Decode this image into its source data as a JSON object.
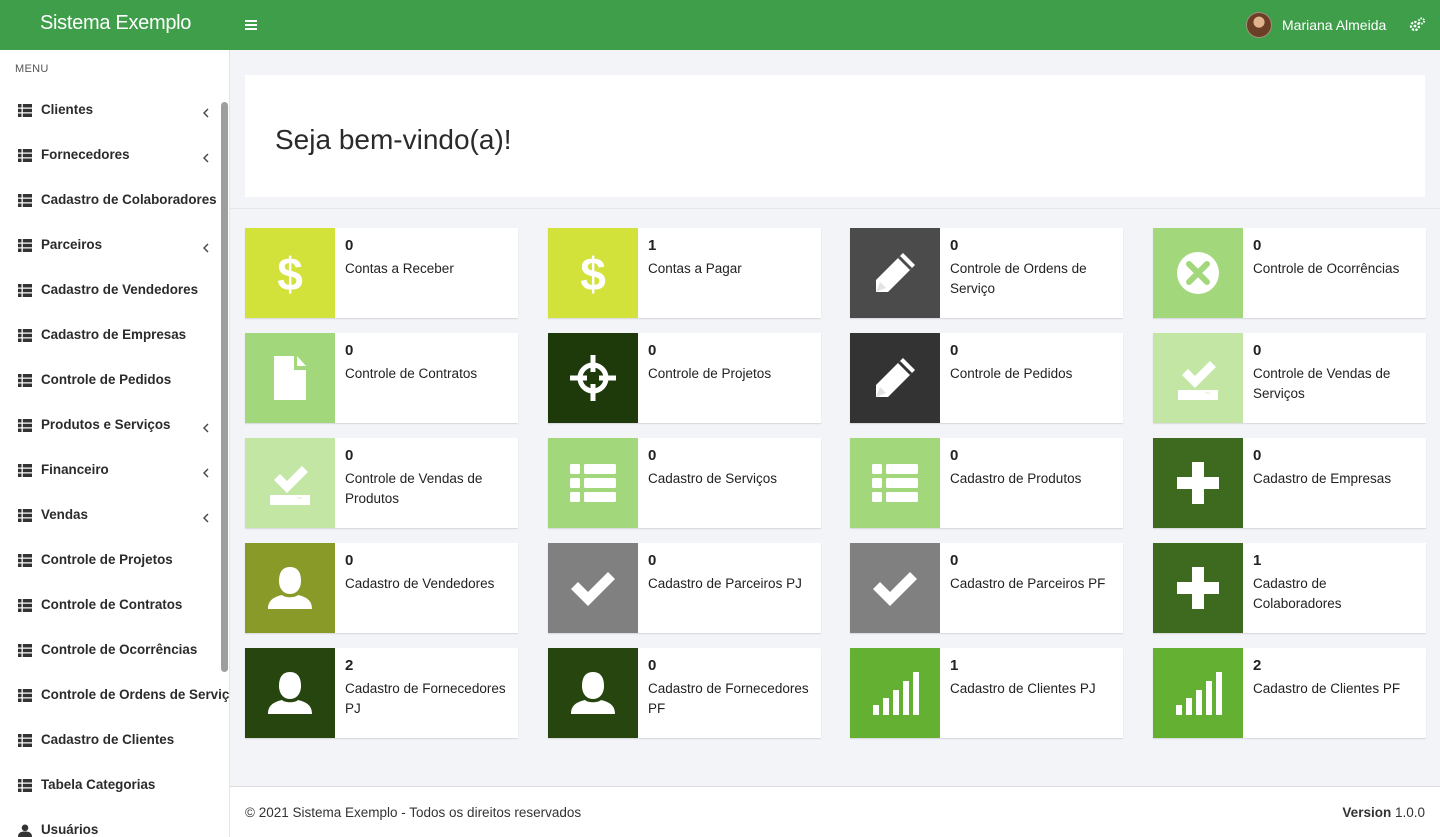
{
  "header": {
    "brand": "Sistema Exemplo",
    "user_name": "Mariana Almeida",
    "color": "#3f9e4a"
  },
  "sidebar": {
    "menu_label": "MENU",
    "items": [
      {
        "label": "Clientes",
        "icon": "th-list-icon",
        "has_submenu": true
      },
      {
        "label": "Fornecedores",
        "icon": "th-list-icon",
        "has_submenu": true
      },
      {
        "label": "Cadastro de Colaboradores",
        "icon": "th-list-icon",
        "has_submenu": false
      },
      {
        "label": "Parceiros",
        "icon": "th-list-icon",
        "has_submenu": true
      },
      {
        "label": "Cadastro de Vendedores",
        "icon": "th-list-icon",
        "has_submenu": false
      },
      {
        "label": "Cadastro de Empresas",
        "icon": "th-list-icon",
        "has_submenu": false
      },
      {
        "label": "Controle de Pedidos",
        "icon": "th-list-icon",
        "has_submenu": false
      },
      {
        "label": "Produtos e Serviços",
        "icon": "th-list-icon",
        "has_submenu": true
      },
      {
        "label": "Financeiro",
        "icon": "th-list-icon",
        "has_submenu": true
      },
      {
        "label": "Vendas",
        "icon": "th-list-icon",
        "has_submenu": true
      },
      {
        "label": "Controle de Projetos",
        "icon": "th-list-icon",
        "has_submenu": false
      },
      {
        "label": "Controle de Contratos",
        "icon": "th-list-icon",
        "has_submenu": false
      },
      {
        "label": "Controle de Ocorrências",
        "icon": "th-list-icon",
        "has_submenu": false
      },
      {
        "label": "Controle de Ordens de Serviço",
        "icon": "th-list-icon",
        "has_submenu": false
      },
      {
        "label": "Cadastro de Clientes",
        "icon": "th-list-icon",
        "has_submenu": false
      },
      {
        "label": "Tabela Categorias",
        "icon": "th-list-icon",
        "has_submenu": false
      },
      {
        "label": "Usuários",
        "icon": "user-icon",
        "has_submenu": false
      }
    ]
  },
  "main": {
    "welcome": "Seja bem-vindo(a)!",
    "tiles": [
      {
        "count": "0",
        "label": "Contas a Receber",
        "icon": "dollar-icon",
        "color": "#d2e23a"
      },
      {
        "count": "1",
        "label": "Contas a Pagar",
        "icon": "dollar-icon",
        "color": "#d2e23a"
      },
      {
        "count": "0",
        "label": "Controle de Ordens de Serviço",
        "icon": "pencil-icon",
        "color": "#4b4b4b"
      },
      {
        "count": "0",
        "label": "Controle de Ocorrências",
        "icon": "remove-circle-icon",
        "color": "#a3d77c"
      },
      {
        "count": "0",
        "label": "Controle de Contratos",
        "icon": "file-icon",
        "color": "#a3d77c"
      },
      {
        "count": "0",
        "label": "Controle de Projetos",
        "icon": "screenshot-icon",
        "color": "#1e3a0b"
      },
      {
        "count": "0",
        "label": "Controle de Pedidos",
        "icon": "pencil-icon",
        "color": "#333333"
      },
      {
        "count": "0",
        "label": "Controle de Vendas de Serviços",
        "icon": "check-tray-icon",
        "color": "#c3e6a5"
      },
      {
        "count": "0",
        "label": "Controle de Vendas de Produtos",
        "icon": "check-tray-icon",
        "color": "#c3e6a5"
      },
      {
        "count": "0",
        "label": "Cadastro de Serviços",
        "icon": "th-list-icon",
        "color": "#a3d77c"
      },
      {
        "count": "0",
        "label": "Cadastro de Produtos",
        "icon": "th-list-icon",
        "color": "#a3d77c"
      },
      {
        "count": "0",
        "label": "Cadastro de Empresas",
        "icon": "plus-icon",
        "color": "#3d6a1f"
      },
      {
        "count": "0",
        "label": "Cadastro de Vendedores",
        "icon": "user-icon",
        "color": "#8a9a28"
      },
      {
        "count": "0",
        "label": "Cadastro de Parceiros PJ",
        "icon": "check-icon",
        "color": "#808080"
      },
      {
        "count": "0",
        "label": "Cadastro de Parceiros PF",
        "icon": "check-icon",
        "color": "#808080"
      },
      {
        "count": "1",
        "label": "Cadastro de Colaboradores",
        "icon": "plus-icon",
        "color": "#3d6a1f"
      },
      {
        "count": "2",
        "label": "Cadastro de Fornecedores PJ",
        "icon": "user-icon",
        "color": "#26450f"
      },
      {
        "count": "0",
        "label": "Cadastro de Fornecedores PF",
        "icon": "user-icon",
        "color": "#26450f"
      },
      {
        "count": "1",
        "label": "Cadastro de Clientes PJ",
        "icon": "signal-icon",
        "color": "#64b033"
      },
      {
        "count": "2",
        "label": "Cadastro de Clientes PF",
        "icon": "signal-icon",
        "color": "#64b033"
      }
    ]
  },
  "footer": {
    "copyright": "© 2021 Sistema Exemplo - Todos os direitos reservados",
    "version_label": "Version",
    "version": "1.0.0"
  }
}
